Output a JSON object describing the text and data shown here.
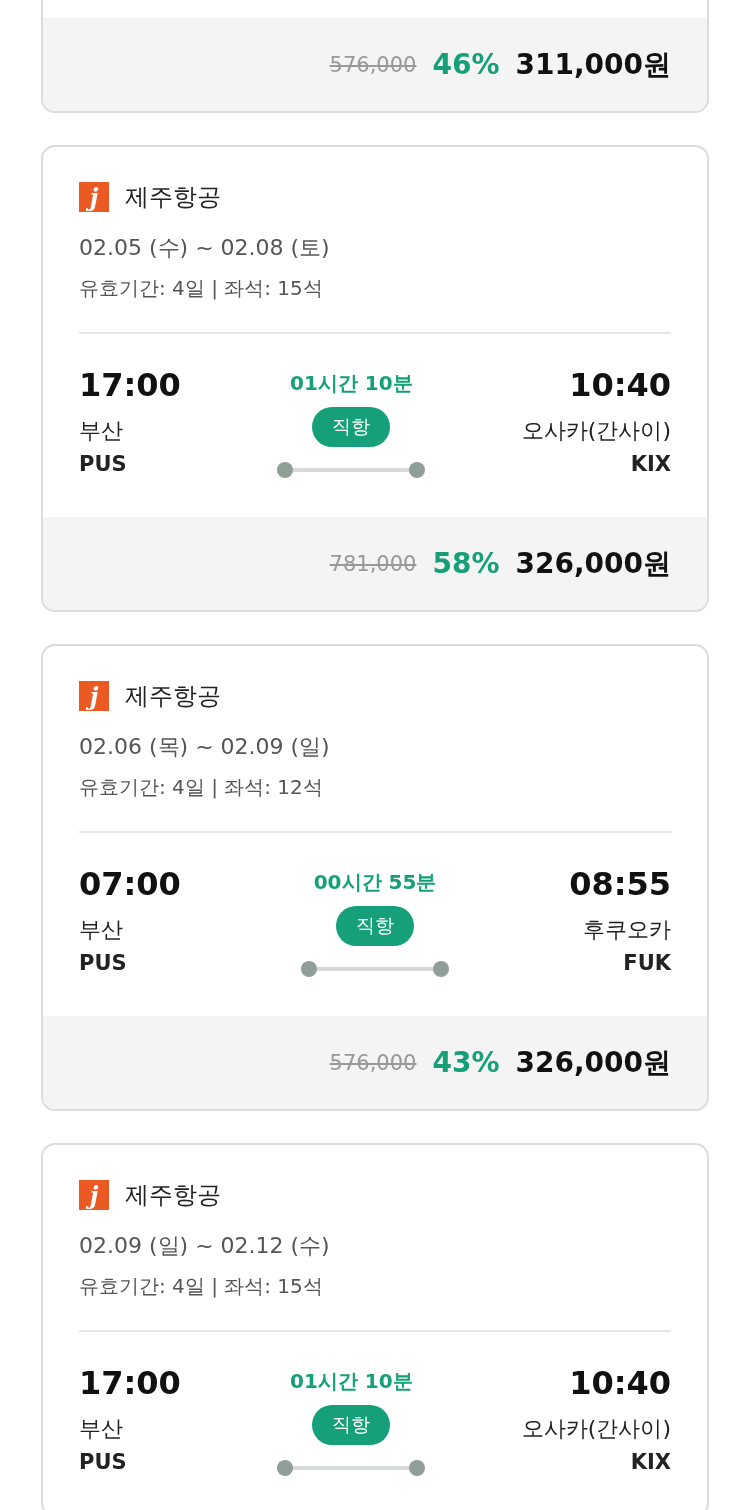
{
  "cards": [
    {
      "partial": true,
      "price": {
        "original": "576,000",
        "discount": "46%",
        "final": "311,000원"
      }
    },
    {
      "partial": false,
      "airline": {
        "logo": "j",
        "name": "제주항공"
      },
      "dates": "02.05 (수) ~ 02.08 (토)",
      "validity": "유효기간: 4일 | 좌석: 15석",
      "departure": {
        "time": "17:00",
        "city": "부산",
        "code": "PUS"
      },
      "duration": "01시간 10분",
      "flight_type": "직항",
      "arrival": {
        "time": "10:40",
        "city": "오사카(간사이)",
        "code": "KIX"
      },
      "price": {
        "original": "781,000",
        "discount": "58%",
        "final": "326,000원"
      }
    },
    {
      "partial": false,
      "airline": {
        "logo": "j",
        "name": "제주항공"
      },
      "dates": "02.06 (목) ~ 02.09 (일)",
      "validity": "유효기간: 4일 | 좌석: 12석",
      "departure": {
        "time": "07:00",
        "city": "부산",
        "code": "PUS"
      },
      "duration": "00시간 55분",
      "flight_type": "직항",
      "arrival": {
        "time": "08:55",
        "city": "후쿠오카",
        "code": "FUK"
      },
      "price": {
        "original": "576,000",
        "discount": "43%",
        "final": "326,000원"
      }
    },
    {
      "partial": false,
      "airline": {
        "logo": "j",
        "name": "제주항공"
      },
      "dates": "02.09 (일) ~ 02.12 (수)",
      "validity": "유효기간: 4일 | 좌석: 15석",
      "departure": {
        "time": "17:00",
        "city": "부산",
        "code": "PUS"
      },
      "duration": "01시간 10분",
      "flight_type": "직항",
      "arrival": {
        "time": "10:40",
        "city": "오사카(간사이)",
        "code": "KIX"
      }
    }
  ]
}
